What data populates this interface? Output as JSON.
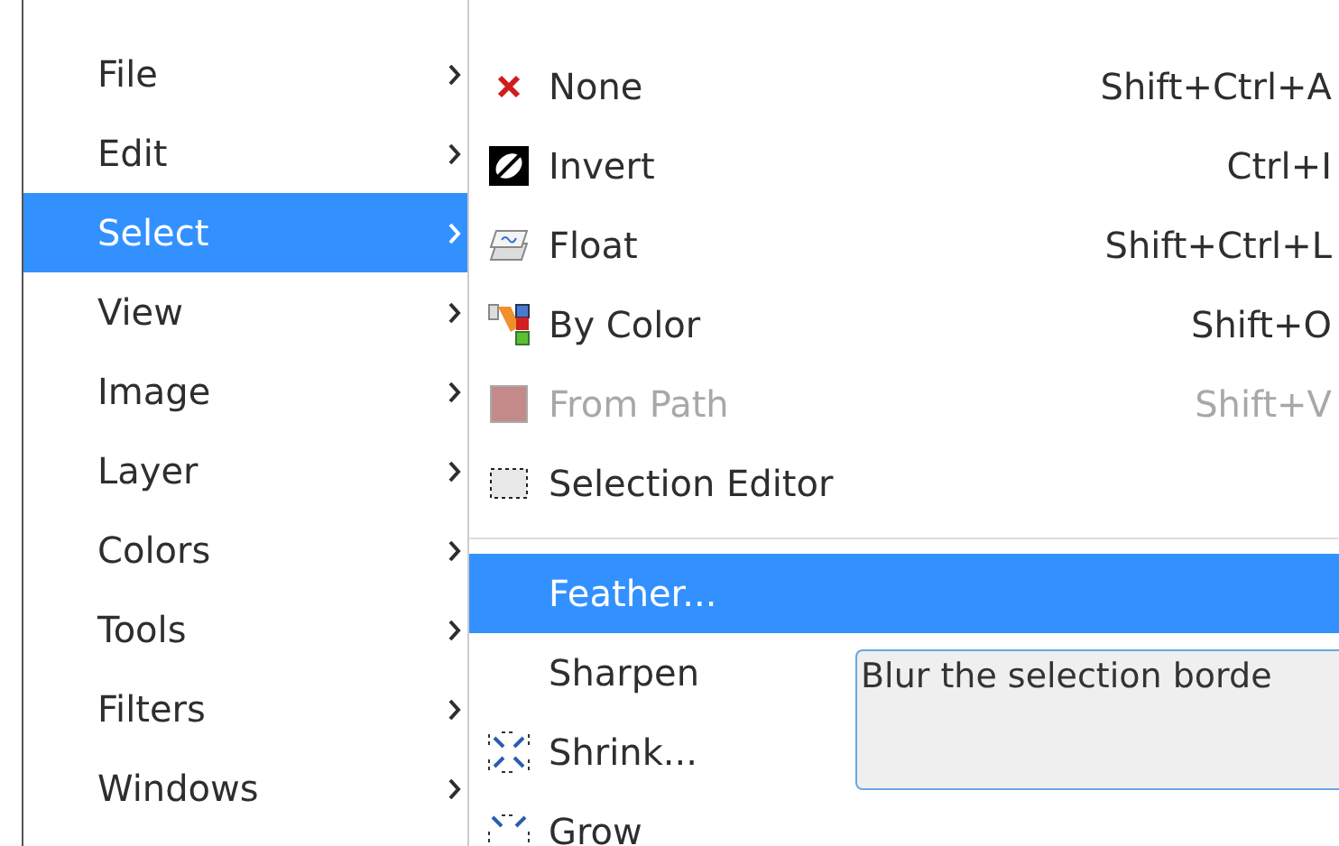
{
  "menu": {
    "items": [
      {
        "label": "File",
        "selected": false
      },
      {
        "label": "Edit",
        "selected": false
      },
      {
        "label": "Select",
        "selected": true
      },
      {
        "label": "View",
        "selected": false
      },
      {
        "label": "Image",
        "selected": false
      },
      {
        "label": "Layer",
        "selected": false
      },
      {
        "label": "Colors",
        "selected": false
      },
      {
        "label": "Tools",
        "selected": false
      },
      {
        "label": "Filters",
        "selected": false
      },
      {
        "label": "Windows",
        "selected": false
      }
    ]
  },
  "submenu": {
    "items": [
      {
        "kind": "item",
        "label": "None",
        "shortcut": "Shift+Ctrl+A",
        "disabled": false,
        "selected": false
      },
      {
        "kind": "item",
        "label": "Invert",
        "shortcut": "Ctrl+I",
        "disabled": false,
        "selected": false
      },
      {
        "kind": "item",
        "label": "Float",
        "shortcut": "Shift+Ctrl+L",
        "disabled": false,
        "selected": false
      },
      {
        "kind": "item",
        "label": "By Color",
        "shortcut": "Shift+O",
        "disabled": false,
        "selected": false
      },
      {
        "kind": "item",
        "label": "From Path",
        "shortcut": "Shift+V",
        "disabled": true,
        "selected": false
      },
      {
        "kind": "item",
        "label": "Selection Editor",
        "disabled": false,
        "selected": false
      },
      {
        "kind": "separator"
      },
      {
        "kind": "item",
        "label": "Feather...",
        "disabled": false,
        "selected": true
      },
      {
        "kind": "item",
        "label": "Sharpen",
        "disabled": false,
        "selected": false
      },
      {
        "kind": "item",
        "label": "Shrink...",
        "disabled": false,
        "selected": false
      },
      {
        "kind": "item",
        "label": "Grow",
        "disabled": false,
        "selected": false
      }
    ]
  },
  "tooltip": {
    "text": "Blur the selection borde"
  }
}
